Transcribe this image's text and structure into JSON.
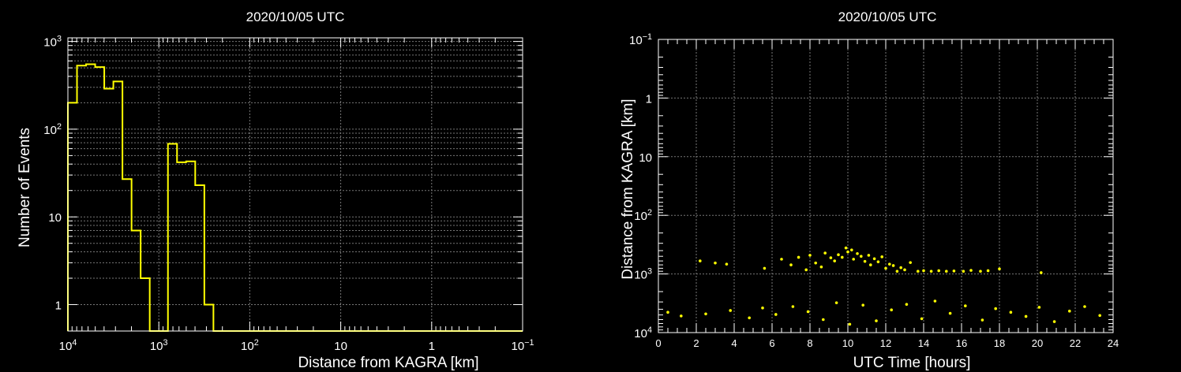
{
  "chart_data": [
    {
      "type": "histogram",
      "title": "2020/10/05 UTC",
      "xlabel": "Distance from KAGRA [km]",
      "ylabel": "Number of Events",
      "x_scale": "log",
      "x_reversed": true,
      "xlim": [
        10000,
        0.1
      ],
      "y_scale": "log",
      "ylim": [
        0.5,
        1100
      ],
      "grid": true,
      "line_color": "#ffff00",
      "x_ticks": [
        {
          "value": 10000,
          "mantissa": "10",
          "exp": "4"
        },
        {
          "value": 1000,
          "mantissa": "10",
          "exp": "3"
        },
        {
          "value": 100,
          "mantissa": "10",
          "exp": "2"
        },
        {
          "value": 10,
          "mantissa": "10",
          "exp": ""
        },
        {
          "value": 1,
          "mantissa": "1",
          "exp": ""
        },
        {
          "value": 0.1,
          "mantissa": "10",
          "exp": "−1"
        }
      ],
      "y_ticks": [
        {
          "value": 1,
          "mantissa": "1",
          "exp": ""
        },
        {
          "value": 10,
          "mantissa": "10",
          "exp": ""
        },
        {
          "value": 100,
          "mantissa": "10",
          "exp": "2"
        },
        {
          "value": 1000,
          "mantissa": "10",
          "exp": "3"
        }
      ],
      "bin_edges": [
        10000,
        7943,
        6310,
        5012,
        3981,
        3162,
        2512,
        1995,
        1585,
        1259,
        1000,
        794,
        631,
        501,
        398,
        316,
        251,
        200,
        158,
        126,
        100,
        0.1
      ],
      "values": [
        200,
        530,
        550,
        510,
        290,
        350,
        27,
        7,
        2,
        0,
        0,
        68,
        42,
        43,
        23,
        1,
        0,
        0,
        0,
        0,
        0
      ]
    },
    {
      "type": "scatter",
      "title": "2020/10/05 UTC",
      "xlabel": "UTC Time [hours]",
      "ylabel": "Distance from KAGRA [km]",
      "xlim": [
        0,
        24
      ],
      "y_scale": "log",
      "y_reversed": true,
      "ylim": [
        0.1,
        10000
      ],
      "grid": true,
      "marker_color": "#ffff00",
      "x_ticks": [
        0,
        2,
        4,
        6,
        8,
        10,
        12,
        14,
        16,
        18,
        20,
        22,
        24
      ],
      "y_ticks": [
        {
          "value": 0.1,
          "mantissa": "10",
          "exp": "−1"
        },
        {
          "value": 1,
          "mantissa": "1",
          "exp": ""
        },
        {
          "value": 10,
          "mantissa": "10",
          "exp": ""
        },
        {
          "value": 100,
          "mantissa": "10",
          "exp": "2"
        },
        {
          "value": 1000,
          "mantissa": "10",
          "exp": "3"
        },
        {
          "value": 10000,
          "mantissa": "10",
          "exp": "4"
        }
      ],
      "points": [
        [
          2.2,
          600
        ],
        [
          3.0,
          650
        ],
        [
          3.6,
          680
        ],
        [
          5.6,
          800
        ],
        [
          6.5,
          560
        ],
        [
          7.0,
          700
        ],
        [
          7.4,
          520
        ],
        [
          7.8,
          850
        ],
        [
          8.0,
          480
        ],
        [
          8.3,
          650
        ],
        [
          8.6,
          760
        ],
        [
          8.8,
          440
        ],
        [
          9.1,
          530
        ],
        [
          9.3,
          600
        ],
        [
          9.5,
          470
        ],
        [
          9.7,
          520
        ],
        [
          9.9,
          360
        ],
        [
          10.0,
          420
        ],
        [
          10.2,
          390
        ],
        [
          10.3,
          560
        ],
        [
          10.5,
          450
        ],
        [
          10.7,
          500
        ],
        [
          10.9,
          610
        ],
        [
          11.1,
          480
        ],
        [
          11.2,
          700
        ],
        [
          11.4,
          550
        ],
        [
          11.6,
          620
        ],
        [
          11.8,
          510
        ],
        [
          12.0,
          800
        ],
        [
          12.2,
          680
        ],
        [
          12.4,
          720
        ],
        [
          12.6,
          900
        ],
        [
          12.8,
          780
        ],
        [
          13.0,
          850
        ],
        [
          13.3,
          640
        ],
        [
          13.7,
          900
        ],
        [
          14.0,
          880
        ],
        [
          14.4,
          900
        ],
        [
          14.8,
          880
        ],
        [
          15.2,
          900
        ],
        [
          15.6,
          890
        ],
        [
          16.1,
          900
        ],
        [
          16.5,
          870
        ],
        [
          17.0,
          900
        ],
        [
          17.4,
          880
        ],
        [
          18.0,
          820
        ],
        [
          20.2,
          950
        ],
        [
          0.5,
          4500
        ],
        [
          1.2,
          5200
        ],
        [
          2.5,
          4800
        ],
        [
          3.8,
          4200
        ],
        [
          4.8,
          5600
        ],
        [
          5.5,
          3800
        ],
        [
          6.2,
          4900
        ],
        [
          7.1,
          3600
        ],
        [
          7.9,
          4400
        ],
        [
          8.7,
          6000
        ],
        [
          9.4,
          3100
        ],
        [
          10.1,
          7200
        ],
        [
          10.8,
          3400
        ],
        [
          11.5,
          6300
        ],
        [
          12.3,
          4100
        ],
        [
          13.1,
          3300
        ],
        [
          13.9,
          5800
        ],
        [
          14.6,
          2900
        ],
        [
          15.4,
          4700
        ],
        [
          16.2,
          3500
        ],
        [
          17.1,
          6100
        ],
        [
          17.8,
          3900
        ],
        [
          18.6,
          4500
        ],
        [
          19.4,
          5300
        ],
        [
          20.1,
          3700
        ],
        [
          20.9,
          6500
        ],
        [
          21.7,
          4300
        ],
        [
          22.5,
          3600
        ],
        [
          23.3,
          5100
        ]
      ]
    }
  ]
}
